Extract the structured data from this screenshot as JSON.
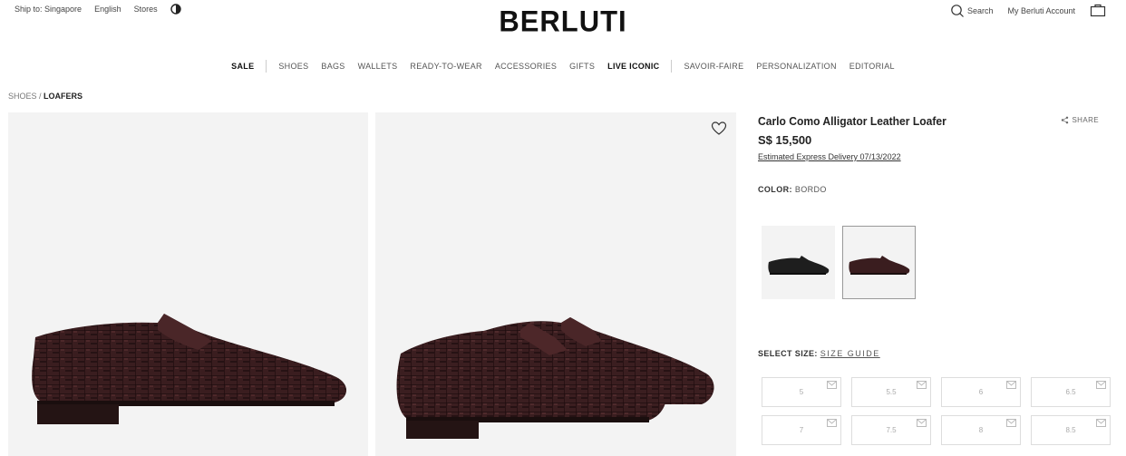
{
  "topbar": {
    "ship_to": "Ship to: Singapore",
    "language": "English",
    "stores": "Stores",
    "contrast_icon": "contrast-icon",
    "search": "Search",
    "account": "My Berluti Account",
    "bag_icon": "shopping-bag-icon"
  },
  "brand": "BERLUTI",
  "nav": {
    "items": [
      "SALE",
      "SHOES",
      "BAGS",
      "WALLETS",
      "READY-TO-WEAR",
      "ACCESSORIES",
      "GIFTS",
      "LIVE ICONIC",
      "SAVOIR-FAIRE",
      "PERSONALIZATION",
      "EDITORIAL"
    ]
  },
  "breadcrumb": {
    "parent": "SHOES /",
    "current": "LOAFERS"
  },
  "product": {
    "title": "Carlo Como Alligator Leather Loafer",
    "share": "SHARE",
    "price": "S$ 15,500",
    "delivery": "Estimated Express Delivery 07/13/2022",
    "color_label": "COLOR:",
    "color_value": "BORDO",
    "size_label": "SELECT SIZE:",
    "size_guide": "SIZE GUIDE",
    "sizes": [
      "5",
      "5.5",
      "6",
      "6.5",
      "7",
      "7.5",
      "8",
      "8.5"
    ]
  },
  "colors": {
    "leather": "#3a1d1f",
    "leather_hi": "#6a3a3a",
    "swatch_black": "#1e1e1e"
  }
}
